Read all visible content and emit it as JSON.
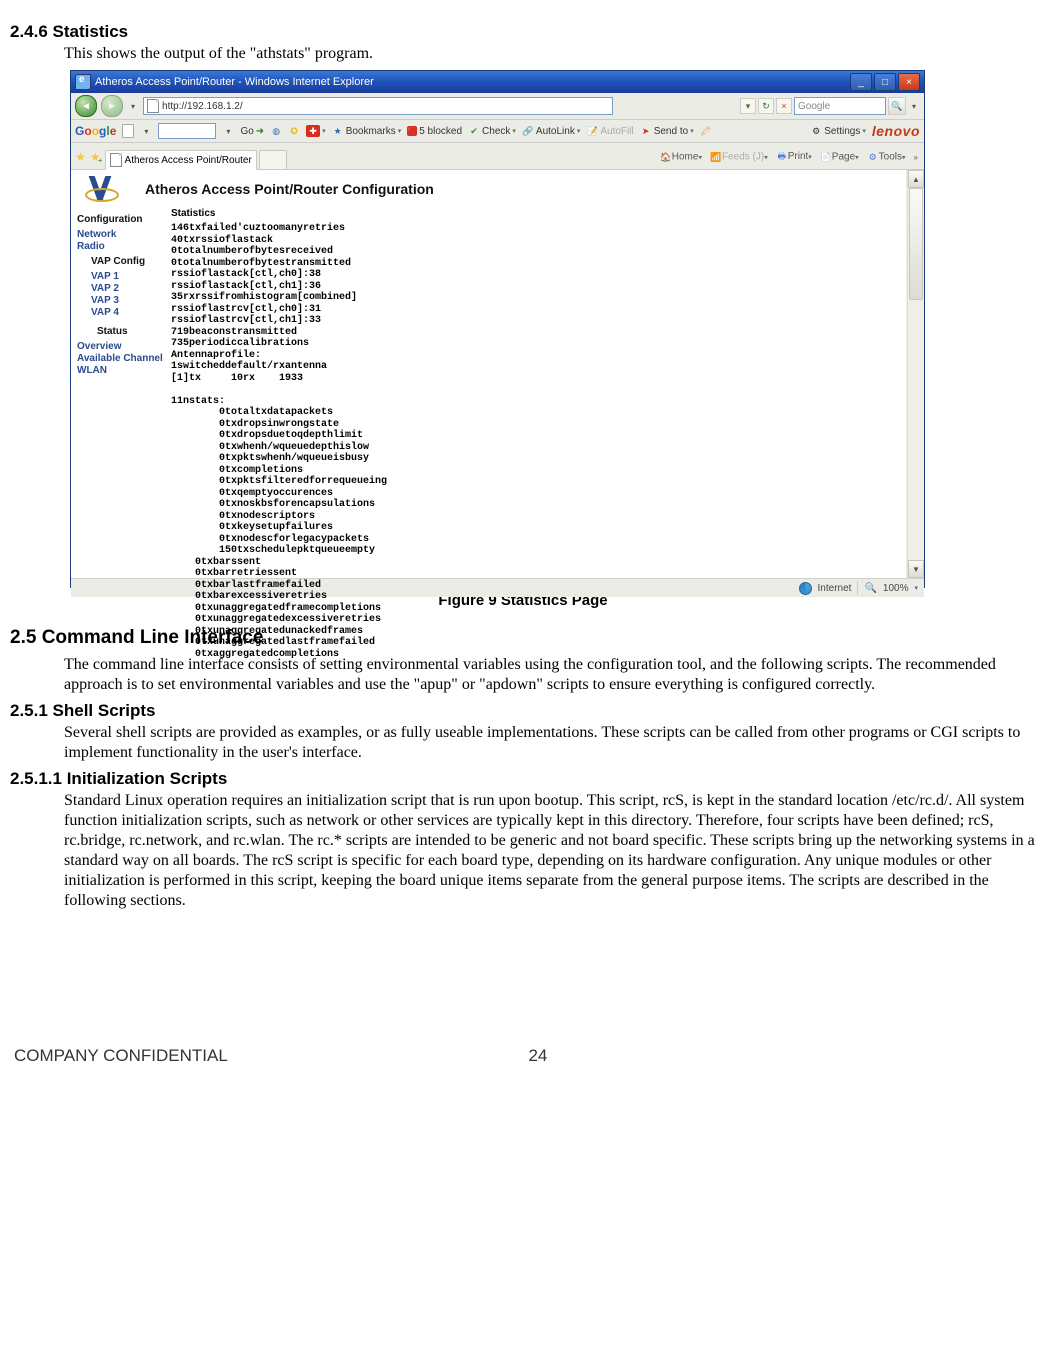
{
  "sections": {
    "s1_num": "2.4.6 Statistics",
    "s1_text": "This shows the output of the \"athstats\" program.",
    "caption": "Figure 9 Statistics Page",
    "s2_num": "2.5 Command Line Interface",
    "s2_text": "The command line interface consists of setting environmental variables using the configuration tool, and the following scripts. The recommended approach is to set environmental variables and use the \"apup\" or \"apdown\" scripts to ensure everything is configured correctly.",
    "s3_num": "2.5.1 Shell Scripts",
    "s3_text": "Several shell scripts are provided as examples, or as fully useable implementations. These scripts can be called from other programs or CGI scripts to implement functionality in the user's interface.",
    "s4_num": "2.5.1.1 Initialization Scripts",
    "s4_text": "Standard Linux operation requires an initialization script that is run upon bootup. This script, rcS, is kept in the standard location /etc/rc.d/. All system function initialization scripts, such as network or other services are typically kept in this directory. Therefore, four scripts have been defined; rcS, rc.bridge, rc.network, and rc.wlan. The rc.* scripts are intended to be generic and not board specific. These scripts bring up the networking systems in a standard way on all boards. The rcS script is specific for each board type, depending on its hardware configuration. Any unique modules or other initialization is performed in this script, keeping the board unique items separate from the general purpose items. The scripts are described in the following sections."
  },
  "footer": {
    "left": "COMPANY CONFIDENTIAL",
    "page": "24"
  },
  "browser": {
    "title": "Atheros Access Point/Router - Windows Internet Explorer",
    "url": "http://192.168.1.2/",
    "search_placeholder": "Google",
    "win_min": "_",
    "win_max": "□",
    "win_close": "×",
    "go_arrow": "→",
    "refresh": "↻",
    "x": "×",
    "mag": "🔍",
    "google": {
      "label": "Google",
      "go": "Go",
      "bookmarks": "Bookmarks",
      "blocked": "5 blocked",
      "check": "Check",
      "autolink": "AutoLink",
      "autofill": "AutoFill",
      "sendto": "Send to",
      "settings": "Settings",
      "lenovo": "lenovo"
    },
    "tab_label": "Atheros Access Point/Router",
    "tools": {
      "home": "Home",
      "feeds": "Feeds (J)",
      "print": "Print",
      "page": "Page",
      "tools": "Tools"
    },
    "app_title": "Atheros Access Point/Router Configuration",
    "sidebar": {
      "configuration": "Configuration",
      "network": "Network",
      "radio": "Radio",
      "vapconfig": "VAP Config",
      "vap1": "VAP 1",
      "vap2": "VAP 2",
      "vap3": "VAP 3",
      "vap4": "VAP 4",
      "status": "Status",
      "overview": "Overview",
      "avail": "Available Channel",
      "wlan": "WLAN"
    },
    "stats": {
      "heading": "Statistics",
      "lines": [
        "146txfailed'cuztoomanyretries",
        "40txrssioflastack",
        "0totalnumberofbytesreceived",
        "0totalnumberofbytestransmitted",
        "rssioflastack[ctl,ch0]:38",
        "rssioflastack[ctl,ch1]:36",
        "35rxrssifromhistogram[combined]",
        "rssioflastrcv[ctl,ch0]:31",
        "rssioflastrcv[ctl,ch1]:33",
        "719beaconstransmitted",
        "735periodiccalibrations",
        "Antennaprofile:",
        "1switcheddefault/rxantenna",
        "[1]tx     10rx    1933",
        "",
        "11nstats:"
      ],
      "indent1": [
        "0totaltxdatapackets",
        "0txdropsinwrongstate",
        "0txdropsduetoqdepthlimit",
        "0txwhenh/wqueuedepthislow",
        "0txpktswhenh/wqueueisbusy",
        "0txcompletions",
        "0txpktsfilteredforrequeueing",
        "0txqemptyoccurences",
        "0txnoskbsforencapsulations",
        "0txnodescriptors",
        "0txkeysetupfailures",
        "0txnodescforlegacypackets",
        "150txschedulepktqueueempty"
      ],
      "indent2": [
        "0txbarssent",
        "0txbarretriessent",
        "0txbarlastframefailed",
        "0txbarexcessiveretries",
        "0txunaggregatedframecompletions",
        "0txunaggregatedexcessiveretries",
        "0txunaggregatedunackedframes",
        "0txunaggregatedlastframefailed",
        "0txaggregatedcompletions"
      ]
    },
    "status": {
      "zone": "Internet",
      "zoom": "100%"
    }
  }
}
